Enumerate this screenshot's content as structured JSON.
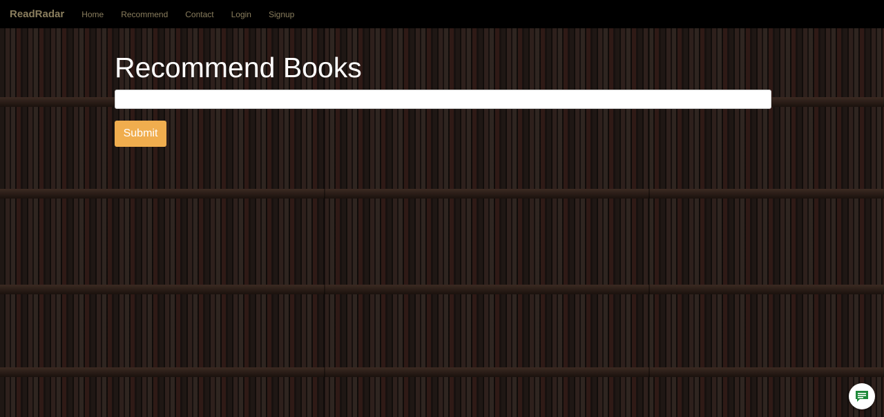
{
  "nav": {
    "brand": "ReadRadar",
    "links": [
      "Home",
      "Recommend",
      "Contact",
      "Login",
      "Signup"
    ]
  },
  "main": {
    "title": "Recommend Books",
    "input_value": "",
    "submit_label": "Submit"
  },
  "chat": {
    "icon": "chat-icon"
  },
  "colors": {
    "navbar_bg": "#000000",
    "nav_text": "#8a7e5e",
    "submit_bg": "#f0ad4e",
    "chat_icon": "#1e8a3a"
  }
}
